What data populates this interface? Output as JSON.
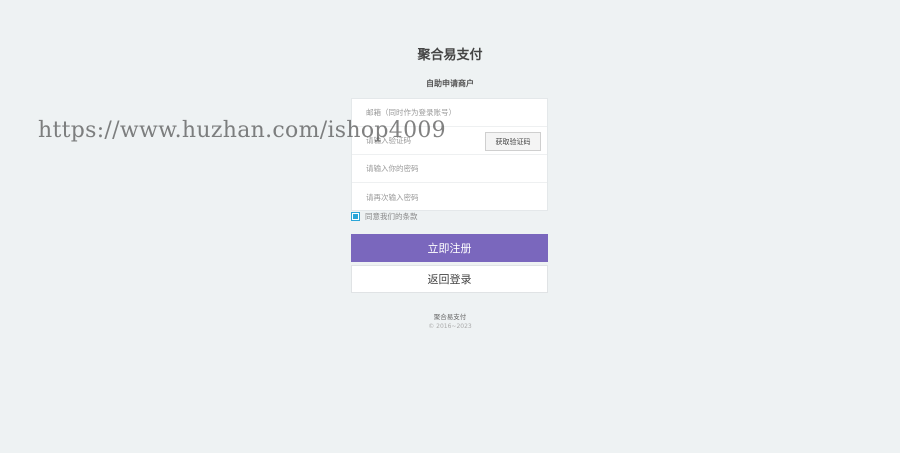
{
  "header": {
    "title": "聚合易支付",
    "subtitle": "自助申请商户"
  },
  "form": {
    "email_placeholder": "邮箱（同时作为登录账号）",
    "code_placeholder": "请输入验证码",
    "get_code_label": "获取验证码",
    "password_placeholder": "请输入你的密码",
    "confirm_password_placeholder": "请再次输入密码",
    "agree_label": "同意我们的条款",
    "agree_checked": true
  },
  "actions": {
    "register_label": "立即注册",
    "login_label": "返回登录"
  },
  "footer": {
    "name": "聚合易支付",
    "copyright": "© 2016~2023"
  },
  "watermark": {
    "text": "https://www.huzhan.com/ishop4009"
  },
  "colors": {
    "background": "#eef2f3",
    "primary_button": "#7a67bd",
    "checkbox_accent": "#2aa6d8"
  }
}
